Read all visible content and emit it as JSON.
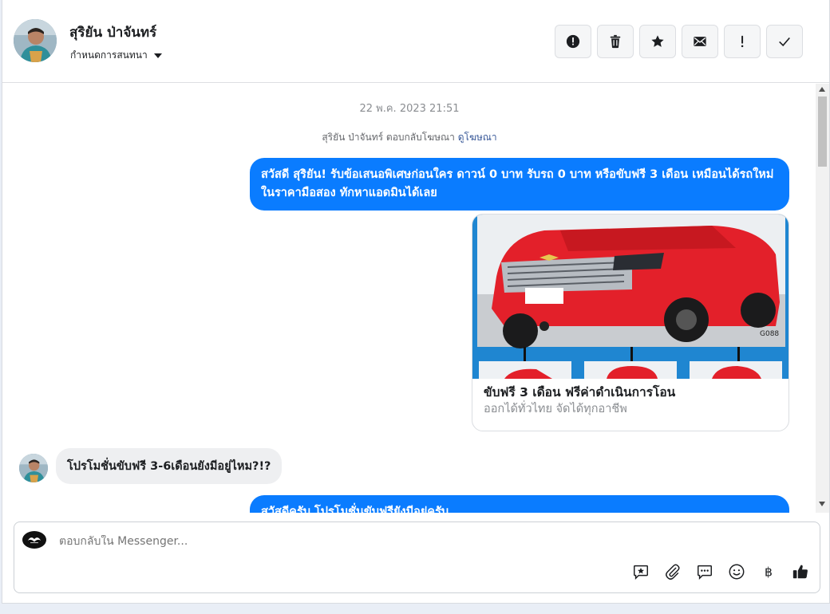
{
  "header": {
    "name": "สุริยัน ป่าจันทร์",
    "assign_label": "กำหนดการสนทนา",
    "actions": [
      {
        "icon": "alert-circle-icon",
        "label": "Spam"
      },
      {
        "icon": "trash-icon",
        "label": "Delete"
      },
      {
        "icon": "star-icon",
        "label": "Star"
      },
      {
        "icon": "envelope-icon",
        "label": "Mark unread"
      },
      {
        "icon": "exclamation-icon",
        "label": "Follow up"
      },
      {
        "icon": "check-icon",
        "label": "Done"
      }
    ]
  },
  "thread": {
    "timestamp": "22 พ.ค. 2023 21:51",
    "replied_text": "สุริยัน ป่าจันทร์ ตอบกลับโฆษณา",
    "view_ad_link": "ดูโฆษณา",
    "outgoing_1": "สวัสดี สุริยัน! รับข้อเสนอพิเศษก่อนใคร ดาวน์ 0 บาท รับรถ 0 บาท หรือขับฟรี 3 เดือน เหมือนได้รถใหม่ ในราคามือสอง ทักหาแอดมินได้เลย",
    "card": {
      "title": "ขับฟรี 3 เดือน ฟรีค่าดำเนินการโอน",
      "subtitle": "ออกได้ทั่วไทย จัดได้ทุกอาชีพ",
      "image_code": "G088"
    },
    "incoming_1": "โปรโมชั่นขับฟรี 3-6เดือนยังมีอยู่ไหม?!?",
    "outgoing_2": "สวัสดีครับ โปรโมชั่นขับฟรียังมีอยู่ครับ"
  },
  "composer": {
    "placeholder": "ตอบกลับใน Messenger...",
    "tools": [
      "saved-reply-icon",
      "attachment-icon",
      "chat-icon",
      "emoji-icon",
      "baht-icon",
      "thumbs-up-icon"
    ]
  },
  "colors": {
    "accent": "#0a7cff",
    "incoming_bg": "#eeeff1",
    "link": "#385898"
  }
}
